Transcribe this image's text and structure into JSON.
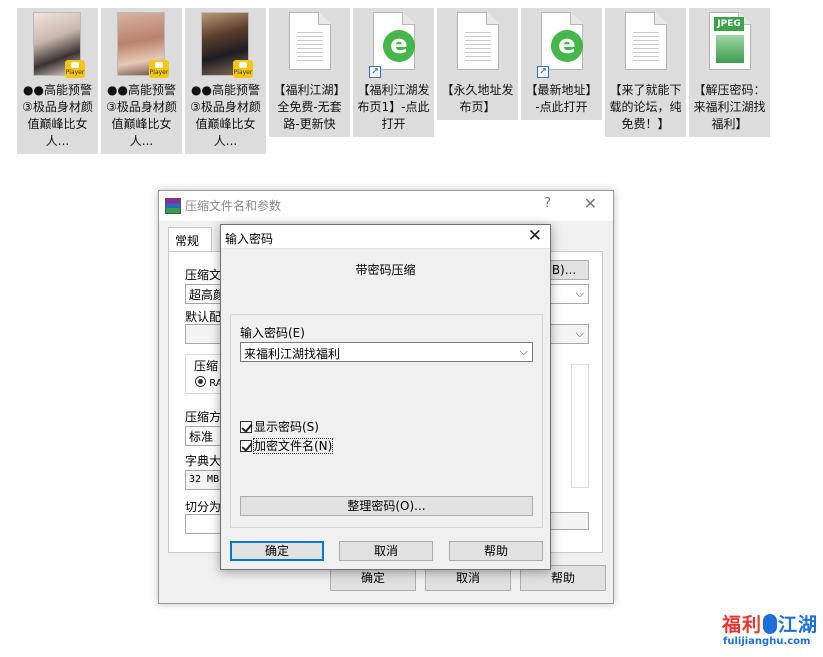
{
  "desktop": {
    "icons": [
      {
        "caption": "●●高能预警③极品身材颜值巅峰比女人...",
        "kind": "video",
        "badge": "Player"
      },
      {
        "caption": "●●高能预警③极品身材颜值巅峰比女人...",
        "kind": "video",
        "badge": "Player"
      },
      {
        "caption": "●●高能预警③极品身材颜值巅峰比女人...",
        "kind": "video",
        "badge": "Player"
      },
      {
        "caption": "【福利江湖】全免费-无套路-更新快",
        "kind": "text-document"
      },
      {
        "caption": "【福利江湖发布页1】-点此打开",
        "kind": "ie-shortcut"
      },
      {
        "caption": "【永久地址发布页】",
        "kind": "text-document"
      },
      {
        "caption": "【最新地址】-点此打开",
        "kind": "ie-shortcut"
      },
      {
        "caption": "【来了就能下载的论坛，纯免费！】",
        "kind": "text-document"
      },
      {
        "caption": "【解压密码：来福利江湖找福利】",
        "kind": "jpeg",
        "badge": "JPEG"
      }
    ]
  },
  "rar_dialog": {
    "title": "压缩文件名和参数",
    "help_glyph": "?",
    "close_glyph": "✕",
    "tab_general": "常规",
    "archive_name_label": "压缩文",
    "archive_name_value": "超高颜",
    "browse_button": "B)...",
    "profile_label": "默认配",
    "format_group_label": "压缩",
    "format_radio": "RA",
    "method_label": "压缩方",
    "method_value": "标准",
    "dict_label": "字典大",
    "dict_value": "32 MB",
    "split_label": "切分为",
    "ok": "确定",
    "cancel": "取消",
    "help": "帮助"
  },
  "password_dialog": {
    "title": "输入密码",
    "close_glyph": "✕",
    "header": "带密码压缩",
    "password_label": "输入密码(E)",
    "password_value": "来福利江湖找福利",
    "show_password": "显示密码(S)",
    "show_password_checked": true,
    "encrypt_names": "加密文件名(N)",
    "encrypt_names_checked": true,
    "organize_button": "整理密码(O)...",
    "ok": "确定",
    "cancel": "取消",
    "help": "帮助"
  },
  "watermark": {
    "part1": "福利",
    "part2": "江湖",
    "domain": "fulijianghu.com"
  },
  "colors": {
    "icon_selection_bg": "#dcdcdc",
    "dialog_bg": "#f0f0f0",
    "default_button_border": "#0078d7",
    "watermark_red": "#e53935",
    "watermark_blue": "#1e6fd9"
  }
}
